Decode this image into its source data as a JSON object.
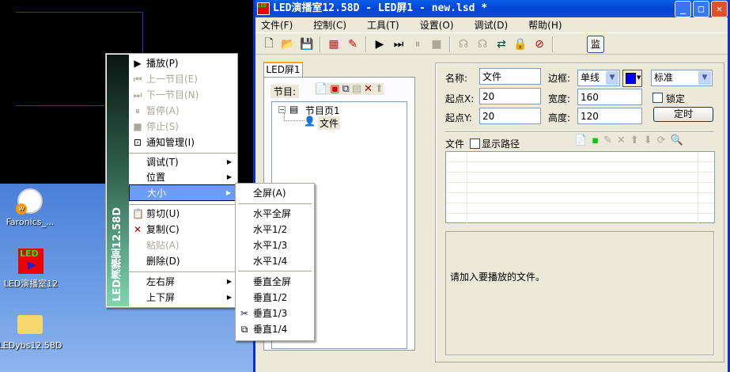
{
  "desktop": {
    "icons": [
      {
        "label": "Faronics_..."
      },
      {
        "label": "LED演播室12"
      },
      {
        "label": "LEDybs12.58D"
      }
    ]
  },
  "window": {
    "title": "LED演播室12.58D - LED屏1 - new.lsd *"
  },
  "menubar": [
    "文件(F)",
    "控制(C)",
    "工具(T)",
    "设置(O)",
    "调试(D)",
    "帮助(H)"
  ],
  "toolbar": {
    "monitor_label": "监"
  },
  "left_panel": {
    "tab": "LED屏1",
    "program_label": "节目:",
    "tree": {
      "page": "节目页1",
      "item": "文件"
    }
  },
  "props": {
    "name_label": "名称:",
    "name_value": "文件",
    "border_label": "边框:",
    "border_value": "单线",
    "border_color": "#0000ff",
    "style_value": "标准",
    "x_label": "起点X:",
    "x_value": "20",
    "width_label": "宽度:",
    "width_value": "160",
    "lock_label": "锁定",
    "y_label": "起点Y:",
    "y_value": "20",
    "height_label": "高度:",
    "height_value": "120",
    "timer_button": "定时",
    "file_label": "文件",
    "show_path_label": "显示路径",
    "hint": "请加入要播放的文件。"
  },
  "context_menu": {
    "sidebar_text": "LED演播室12.58D",
    "items": [
      {
        "label": "播放(P)",
        "icon": "play-icon",
        "enabled": true
      },
      {
        "label": "上一节目(E)",
        "icon": "prev-icon",
        "enabled": false
      },
      {
        "label": "下一节目(N)",
        "icon": "next-icon",
        "enabled": false
      },
      {
        "label": "暂停(A)",
        "icon": "pause-icon",
        "enabled": false
      },
      {
        "label": "停止(S)",
        "icon": "stop-icon",
        "enabled": false
      },
      {
        "label": "通知管理(I)",
        "icon": "notice-icon",
        "enabled": true
      },
      {
        "label": "调试(T)",
        "submenu": true
      },
      {
        "label": "位置",
        "submenu": true
      },
      {
        "label": "大小",
        "submenu": true,
        "highlighted": true
      },
      {
        "label": "剪切(U)",
        "icon": "cut-clipboard-icon",
        "enabled": true
      },
      {
        "label": "复制(C)",
        "icon": "delete-x-icon",
        "enabled": true
      },
      {
        "label": "粘贴(A)",
        "enabled": false
      },
      {
        "label": "删除(D)",
        "enabled": true
      },
      {
        "label": "左右屏",
        "submenu": true
      },
      {
        "label": "上下屏",
        "submenu": true
      }
    ]
  },
  "size_submenu": [
    "全屏(A)",
    "水平全屏",
    "水平1/2",
    "水平1/3",
    "水平1/4",
    "垂直全屏",
    "垂直1/2",
    "垂直1/3",
    "垂直1/4"
  ]
}
